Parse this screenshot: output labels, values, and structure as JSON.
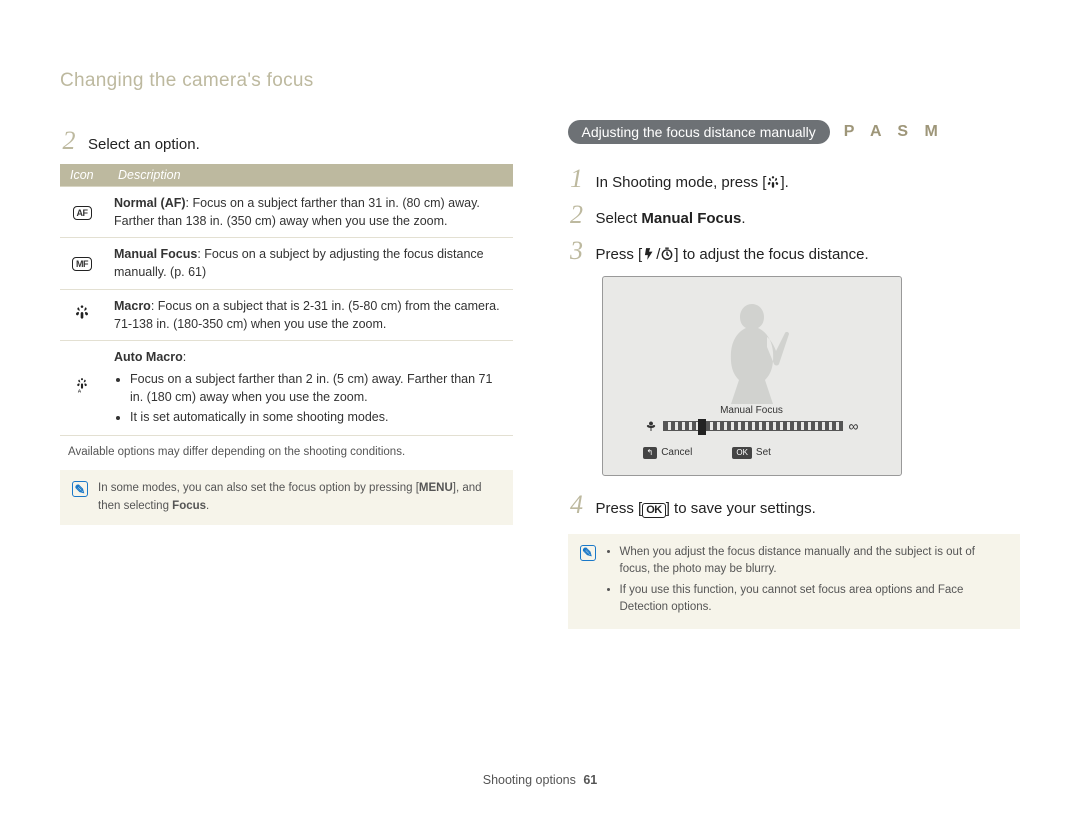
{
  "header": {
    "title": "Changing the camera's focus"
  },
  "left": {
    "step2_num": "2",
    "step2_text": "Select an option.",
    "table": {
      "col_icon": "Icon",
      "col_desc": "Description",
      "rows": [
        {
          "iconName": "af-icon",
          "iconText": "AF",
          "title": "Normal (AF)",
          "body1": ": Focus on a subject farther than 31 in. (80 cm) away. Farther than 138 in. (350 cm) away when you use the zoom."
        },
        {
          "iconName": "mf-icon",
          "iconText": "MF",
          "title": "Manual Focus",
          "body1": ": Focus on a subject by adjusting the focus distance manually. (p. 61)"
        },
        {
          "iconName": "macro-icon",
          "title": "Macro",
          "body1": ": Focus on a subject that is 2-31 in. (5-80 cm) from the camera. 71-138 in. (180-350 cm) when you use the zoom."
        },
        {
          "iconName": "auto-macro-icon",
          "title": "Auto Macro",
          "body1": ":",
          "bullet1": "Focus on a subject farther than 2 in. (5 cm) away. Farther than 71 in. (180 cm) away when you use the zoom.",
          "bullet2": "It is set automatically in some shooting modes."
        }
      ]
    },
    "caption": "Available options may differ depending on the shooting conditions.",
    "note_prefix": "In some modes, you can also set the focus option by pressing [",
    "note_menu": "MENU",
    "note_mid": "], and then selecting ",
    "note_focus": "Focus",
    "note_suffix": "."
  },
  "right": {
    "pill": "Adjusting the focus distance manually",
    "modes": "P A S M",
    "step1_num": "1",
    "step1_text_a": "In Shooting mode, press [",
    "step1_text_b": "].",
    "step2_num": "2",
    "step2_text_a": "Select ",
    "step2_bold": "Manual Focus",
    "step2_text_b": ".",
    "step3_num": "3",
    "step3_text_a": "Press [",
    "step3_text_b": "/",
    "step3_text_c": "] to adjust the focus distance.",
    "lcd": {
      "label": "Manual Focus",
      "cancel": "Cancel",
      "set": "Set",
      "back_btn": "↰",
      "ok_btn": "OK",
      "inf": "∞"
    },
    "step4_num": "4",
    "step4_text_a": "Press [",
    "step4_ok": "OK",
    "step4_text_b": "] to save your settings.",
    "note_b1": "When you adjust the focus distance manually and the subject is out of focus, the photo may be blurry.",
    "note_b2": "If you use this function, you cannot set focus area options and Face Detection options."
  },
  "footer": {
    "section": "Shooting options",
    "page": "61"
  }
}
